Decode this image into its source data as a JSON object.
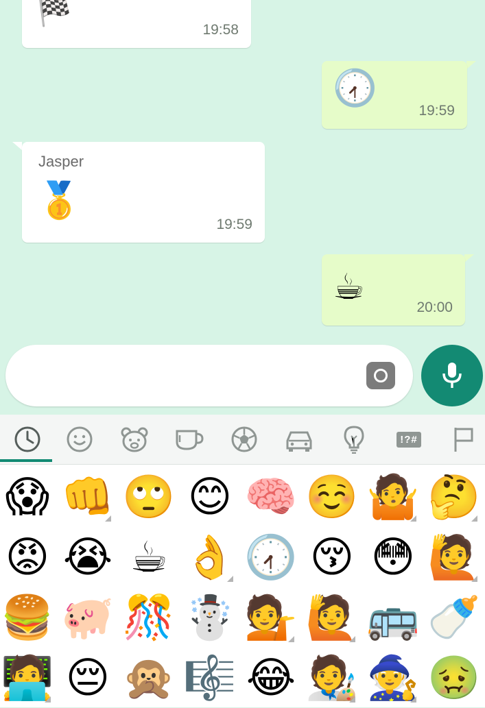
{
  "messages": [
    {
      "direction": "incoming",
      "emoji": "🏁",
      "time": "19:58"
    },
    {
      "direction": "outgoing",
      "emoji": "🕢",
      "time": "19:59"
    },
    {
      "direction": "incoming",
      "sender": "Jasper",
      "emoji": "🥇",
      "time": "19:59"
    },
    {
      "direction": "outgoing",
      "emoji": "☕",
      "time": "20:00"
    }
  ],
  "composer": {
    "placeholder": "",
    "camera_icon": "camera-icon",
    "mic_icon": "microphone-icon"
  },
  "emoji_tabs": [
    {
      "name": "recent",
      "icon": "clock-icon",
      "active": true
    },
    {
      "name": "smileys",
      "icon": "smiley-icon"
    },
    {
      "name": "animals",
      "icon": "bear-icon"
    },
    {
      "name": "food",
      "icon": "cup-icon"
    },
    {
      "name": "activity",
      "icon": "soccer-ball-icon"
    },
    {
      "name": "travel",
      "icon": "car-icon"
    },
    {
      "name": "objects",
      "icon": "lightbulb-icon"
    },
    {
      "name": "symbols",
      "icon": "symbols-icon",
      "text": "!?#"
    },
    {
      "name": "flags",
      "icon": "flag-icon"
    }
  ],
  "emoji_grid": [
    [
      "😱",
      "👊",
      "🙄",
      "😊",
      "🧠",
      "☺️",
      "🤷",
      "🤔"
    ],
    [
      "😡",
      "😭",
      "☕",
      "👌",
      "🕢",
      "😚",
      "😳",
      "🙋"
    ],
    [
      "🍔",
      "🐖",
      "🎊",
      "☃️",
      "💁",
      "🙋",
      "🚌",
      "🍼"
    ],
    [
      "🧑‍💻",
      "😔",
      "🙊",
      "🎼",
      "😂",
      "🧑‍🎨",
      "🧙",
      "🤢"
    ]
  ],
  "colors": {
    "chat_background": "#d7f4e6",
    "outgoing_bubble": "#e6fcc9",
    "incoming_bubble": "#ffffff",
    "accent": "#138a73"
  }
}
